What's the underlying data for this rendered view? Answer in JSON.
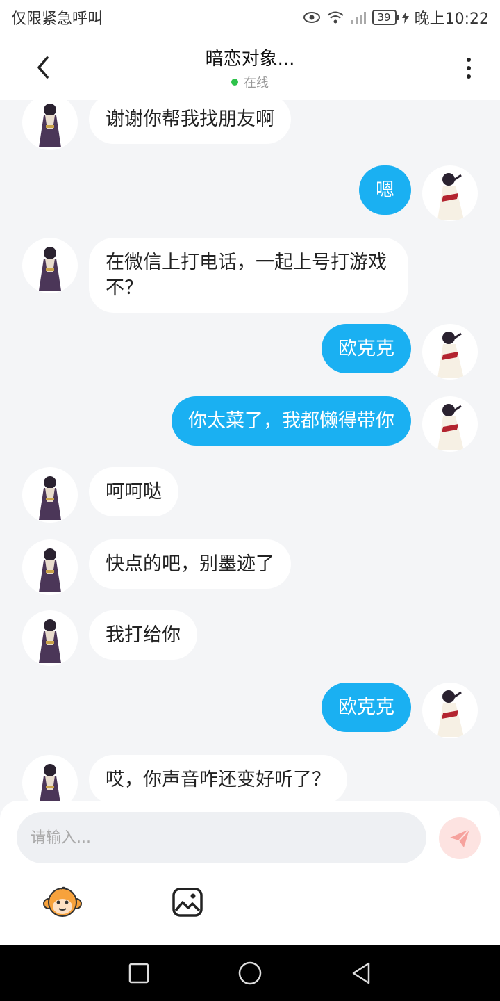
{
  "status_bar": {
    "carrier": "仅限紧急呼叫",
    "battery": "39",
    "time": "晚上10:22"
  },
  "header": {
    "title": "暗恋对象...",
    "status": "在线"
  },
  "messages": [
    {
      "side": "left",
      "text": "谢谢你帮我找朋友啊"
    },
    {
      "side": "right",
      "text": "嗯"
    },
    {
      "side": "left",
      "text": "在微信上打电话，一起上号打游戏不？"
    },
    {
      "side": "right",
      "text": "欧克克"
    },
    {
      "side": "right",
      "text": "你太菜了，我都懒得带你"
    },
    {
      "side": "left",
      "text": "呵呵哒"
    },
    {
      "side": "left",
      "text": "快点的吧，别墨迹了"
    },
    {
      "side": "left",
      "text": "我打给你"
    },
    {
      "side": "right",
      "text": "欧克克"
    },
    {
      "side": "left",
      "text": "哎，你声音咋还变好听了？"
    }
  ],
  "composer": {
    "placeholder": "请输入..."
  },
  "colors": {
    "accent": "#1ab0f2",
    "online": "#2ec24a",
    "send_bg": "#fde3e1",
    "send_icon": "#f6a29d"
  },
  "icons": {
    "back": "chevron-left-icon",
    "more": "more-vertical-icon",
    "send": "paper-plane-icon",
    "sticker": "monkey-face-icon",
    "image": "image-icon"
  }
}
